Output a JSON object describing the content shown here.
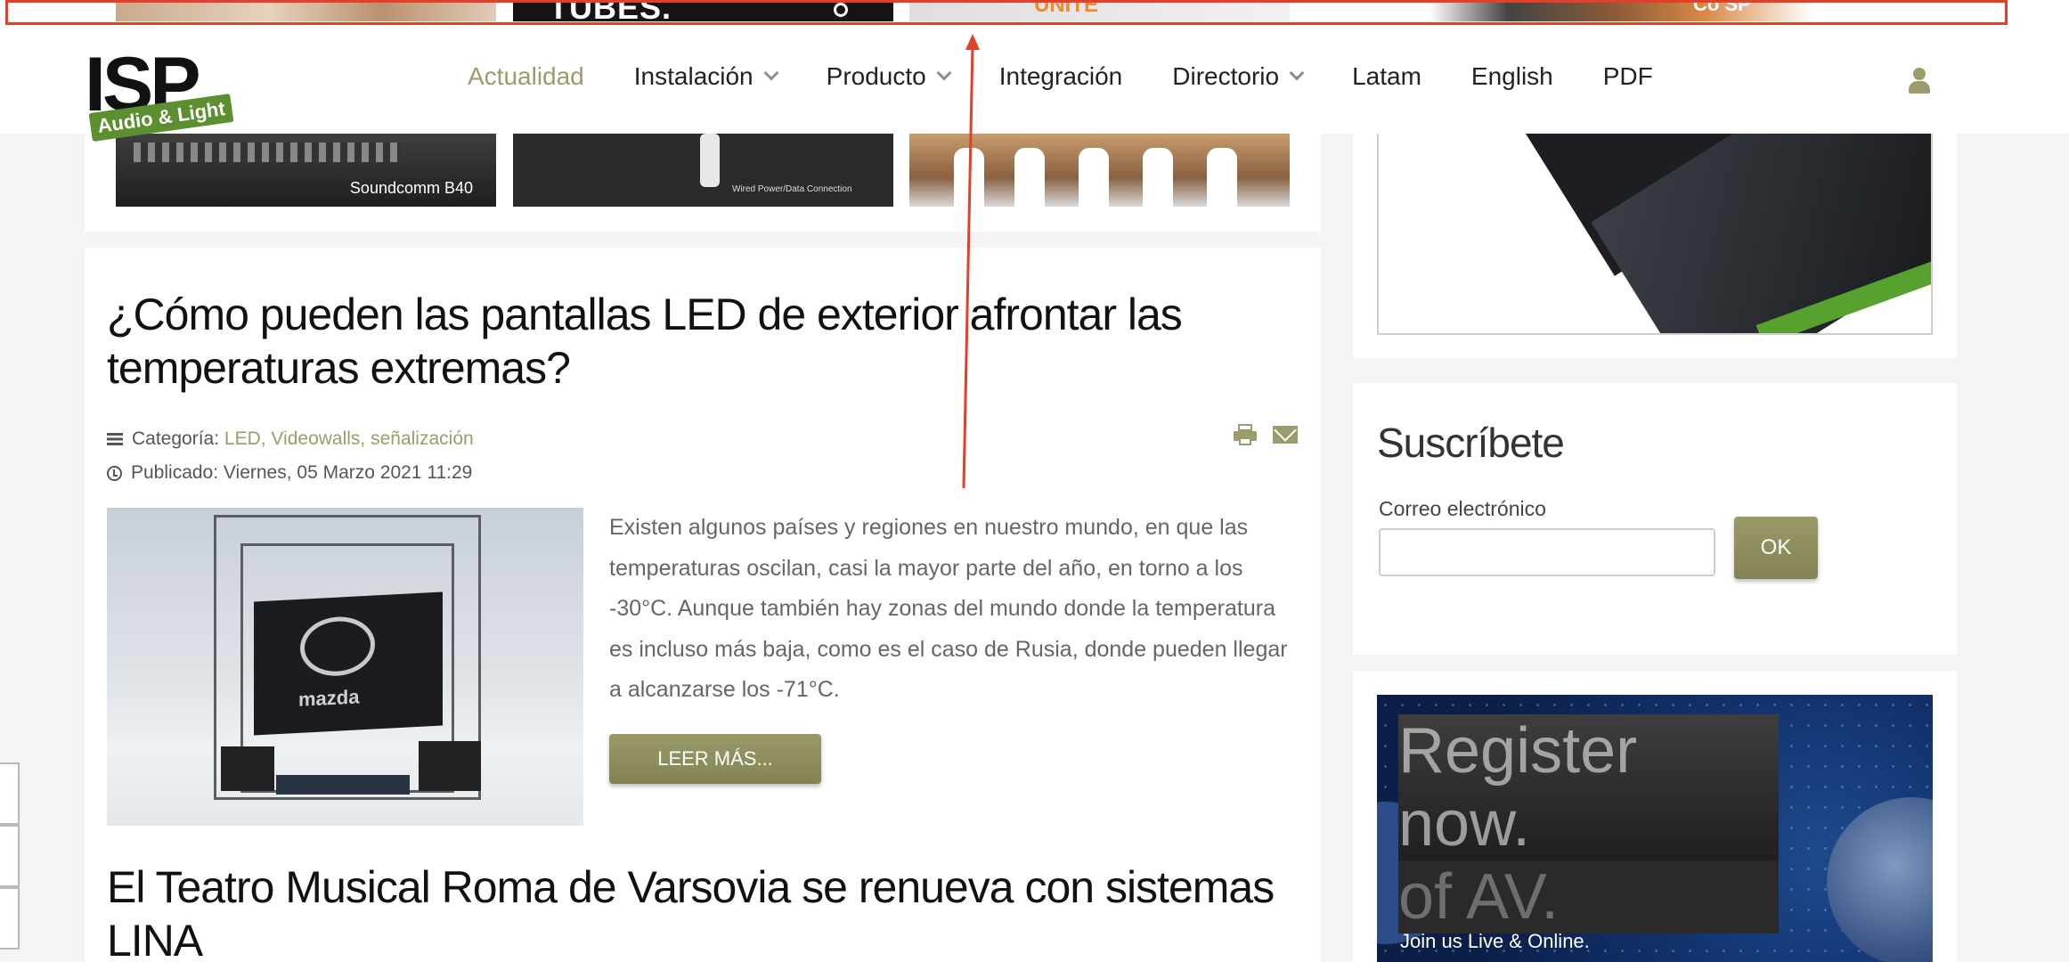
{
  "banner_strip": {
    "item2_text": "TUBES.",
    "item3_text": "UNITE",
    "item4_text": "Co SP"
  },
  "header": {
    "logo_main": "ISP",
    "logo_sub": "Audio & Light",
    "nav": [
      {
        "label": "Actualidad",
        "active": true,
        "dropdown": false
      },
      {
        "label": "Instalación",
        "active": false,
        "dropdown": true
      },
      {
        "label": "Producto",
        "active": false,
        "dropdown": true
      },
      {
        "label": "Integración",
        "active": false,
        "dropdown": false
      },
      {
        "label": "Directorio",
        "active": false,
        "dropdown": true
      },
      {
        "label": "Latam",
        "active": false,
        "dropdown": false
      },
      {
        "label": "English",
        "active": false,
        "dropdown": false
      },
      {
        "label": "PDF",
        "active": false,
        "dropdown": false
      }
    ],
    "user_icon": "user-icon"
  },
  "thumbnails": {
    "t1_caption": "Soundcomm B40",
    "t2_caption": "Wired Power/Data Connection"
  },
  "article": {
    "title": "¿Cómo pueden las pantallas LED de exterior afrontar las temperaturas extremas?",
    "category_label": "Categoría:",
    "categories": "LED, Videowalls, señalización",
    "published": "Publicado: Viernes, 05 Marzo 2021 11:29",
    "image_brand": "mazda",
    "excerpt": "Existen algunos países y regiones en nuestro mundo, en que las temperaturas oscilan, casi la mayor parte del año, en torno a los -30°C. Aunque también hay zonas del mundo donde la temperatura es incluso más baja, como es el caso de Rusia, donde pueden llegar a alcanzarse los -71°C.",
    "read_more": "LEER MÁS...",
    "next_title": "El Teatro Musical Roma de Varsovia se renueva con sistemas LINA"
  },
  "sidebar": {
    "subscribe_title": "Suscríbete",
    "email_label": "Correo electrónico",
    "email_value": "",
    "ok_label": "OK",
    "ad_line1": "Register\nnow.",
    "ad_line2": "Discover\nthe Future\nof AV.",
    "ad_join": "Join us Live & Online."
  },
  "colors": {
    "accent": "#9c9b6b",
    "annotation": "#e3402c",
    "logo_green": "#5c8f2f"
  }
}
